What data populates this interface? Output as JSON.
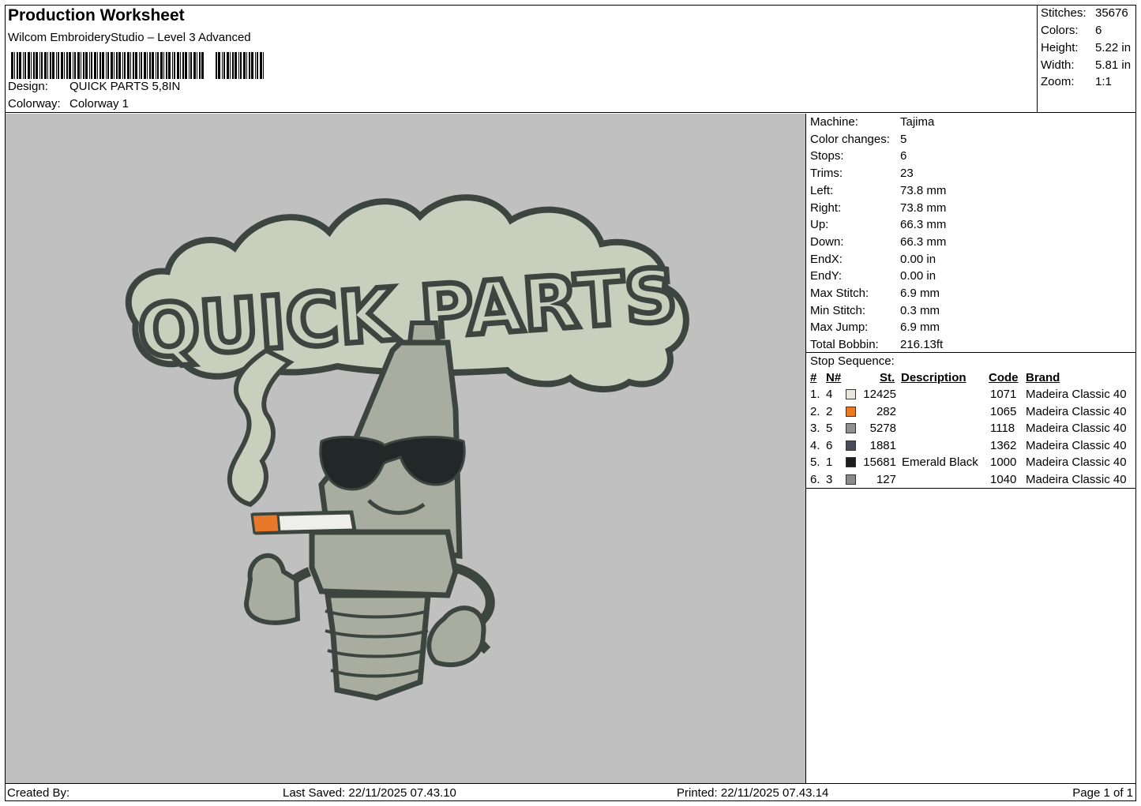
{
  "header": {
    "title": "Production Worksheet",
    "software": "Wilcom EmbroideryStudio – Level 3 Advanced",
    "design_label": "Design:",
    "design_value": "QUICK PARTS 5,8IN",
    "colorway_label": "Colorway:",
    "colorway_value": "Colorway 1"
  },
  "stats": {
    "stitches_label": "Stitches:",
    "stitches": "35676",
    "colors_label": "Colors:",
    "colors": "6",
    "height_label": "Height:",
    "height": "5.22 in",
    "width_label": "Width:",
    "width": "5.81 in",
    "zoom_label": "Zoom:",
    "zoom": "1:1"
  },
  "machine": [
    {
      "label": "Machine:",
      "value": "Tajima"
    },
    {
      "label": "Color changes:",
      "value": "5"
    },
    {
      "label": "Stops:",
      "value": "6"
    },
    {
      "label": "Trims:",
      "value": "23"
    },
    {
      "label": "Left:",
      "value": "73.8 mm"
    },
    {
      "label": "Right:",
      "value": "73.8 mm"
    },
    {
      "label": "Up:",
      "value": "66.3 mm"
    },
    {
      "label": "Down:",
      "value": "66.3 mm"
    },
    {
      "label": "EndX:",
      "value": "0.00 in"
    },
    {
      "label": "EndY:",
      "value": "0.00 in"
    },
    {
      "label": "Max Stitch:",
      "value": "6.9 mm"
    },
    {
      "label": "Min Stitch:",
      "value": "0.3 mm"
    },
    {
      "label": "Max Jump:",
      "value": "6.9 mm"
    },
    {
      "label": "Total Bobbin:",
      "value": "216.13ft"
    }
  ],
  "stop_sequence": {
    "title": "Stop Sequence:",
    "headers": {
      "num": "#",
      "n": "N#",
      "st": "St.",
      "desc": "Description",
      "code": "Code",
      "brand": "Brand"
    },
    "rows": [
      {
        "num": "1.",
        "n": "4",
        "color": "#e8e8e0",
        "st": "12425",
        "desc": "",
        "code": "1071",
        "brand": "Madeira Classic 40"
      },
      {
        "num": "2.",
        "n": "2",
        "color": "#e87a20",
        "st": "282",
        "desc": "",
        "code": "1065",
        "brand": "Madeira Classic 40"
      },
      {
        "num": "3.",
        "n": "5",
        "color": "#909090",
        "st": "5278",
        "desc": "",
        "code": "1118",
        "brand": "Madeira Classic 40"
      },
      {
        "num": "4.",
        "n": "6",
        "color": "#4a4a58",
        "st": "1881",
        "desc": "",
        "code": "1362",
        "brand": "Madeira Classic 40"
      },
      {
        "num": "5.",
        "n": "1",
        "color": "#1e1e1e",
        "st": "15681",
        "desc": "Emerald Black",
        "code": "1000",
        "brand": "Madeira Classic 40"
      },
      {
        "num": "6.",
        "n": "3",
        "color": "#8a8a8a",
        "st": "127",
        "desc": "",
        "code": "1040",
        "brand": "Madeira Classic 40"
      }
    ]
  },
  "artwork": {
    "text": "QUICK PARTS",
    "colors": {
      "cloud": "#c9cfbd",
      "outline": "#3c4540",
      "body": "#a9ad9f",
      "glasses": "#222828",
      "orange": "#e8782a",
      "cig": "#eeeeea"
    }
  },
  "footer": {
    "created_by": "Created By:",
    "last_saved": "Last Saved: 22/11/2025 07.43.10",
    "printed": "Printed: 22/11/2025 07.43.14",
    "page": "Page 1 of 1"
  }
}
